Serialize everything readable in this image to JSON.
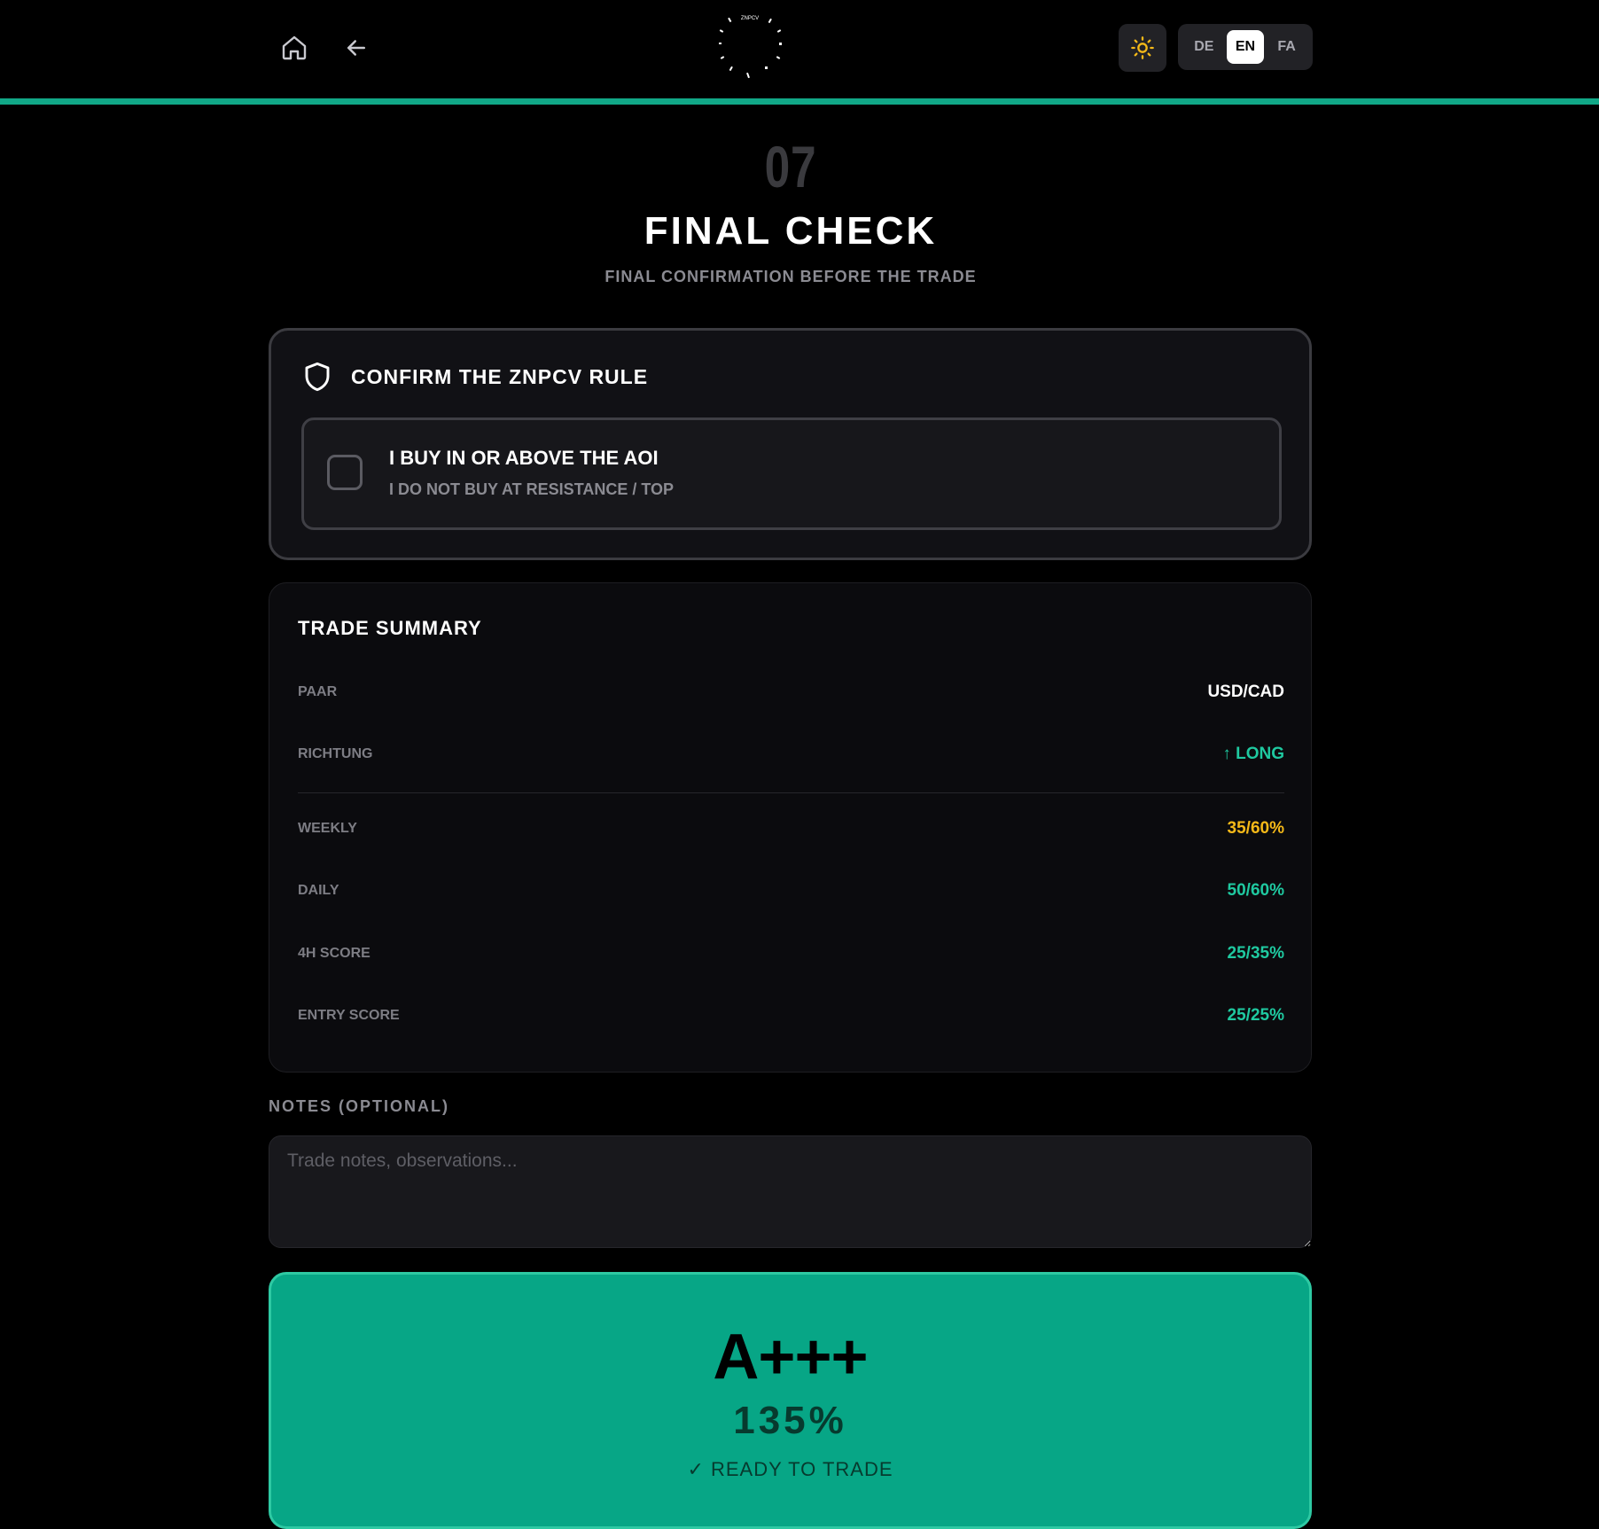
{
  "header": {
    "logo_text": "ZNPCV",
    "languages": [
      "DE",
      "EN",
      "FA"
    ],
    "active_language": "EN",
    "accent_color": "#11a887"
  },
  "step": {
    "number": "07",
    "title": "FINAL CHECK",
    "subtitle": "FINAL CONFIRMATION BEFORE THE TRADE"
  },
  "confirm": {
    "title": "CONFIRM THE ZNPCV RULE",
    "rule_title": "I BUY IN OR ABOVE THE AOI",
    "rule_subtitle": "I DO NOT BUY AT RESISTANCE / TOP",
    "checked": false
  },
  "summary": {
    "title": "TRADE SUMMARY",
    "rows": [
      {
        "label": "PAAR",
        "value": "USD/CAD",
        "color": "#ffffff"
      },
      {
        "label": "RICHTUNG",
        "value": "↑ LONG",
        "color": "#1fc9a0"
      },
      {
        "label": "WEEKLY",
        "value": "35/60%",
        "color": "#f5b918"
      },
      {
        "label": "DAILY",
        "value": "50/60%",
        "color": "#1fc9a0"
      },
      {
        "label": "4H SCORE",
        "value": "25/35%",
        "color": "#1fc9a0"
      },
      {
        "label": "ENTRY SCORE",
        "value": "25/25%",
        "color": "#1fc9a0"
      }
    ]
  },
  "notes": {
    "label": "NOTES (OPTIONAL)",
    "placeholder": "Trade notes, observations...",
    "value": ""
  },
  "result": {
    "grade": "A+++",
    "score": "135%",
    "status": "✓ READY TO TRADE",
    "color": "#07a686"
  }
}
